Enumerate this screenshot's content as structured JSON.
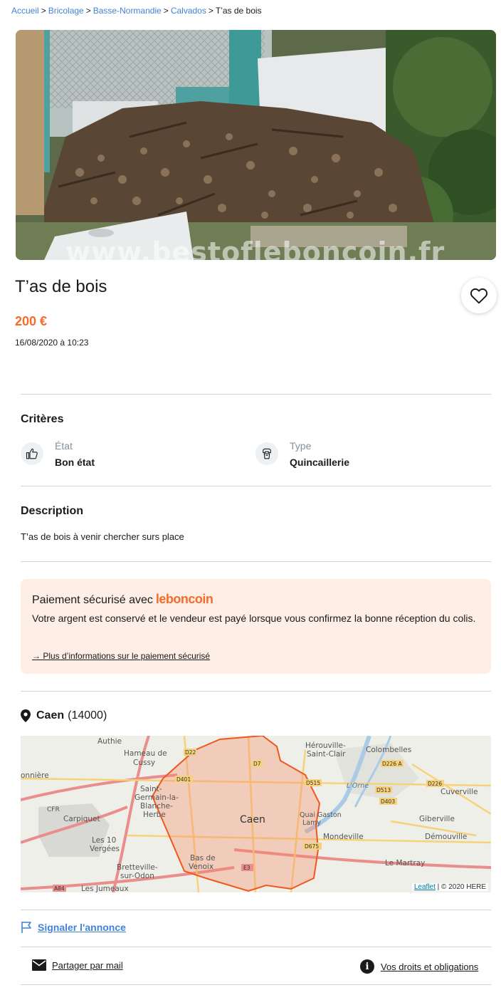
{
  "breadcrumb": {
    "items": [
      "Accueil",
      "Bricolage",
      "Basse-Normandie",
      "Calvados"
    ],
    "current": "T’as de bois",
    "separator": ">"
  },
  "ad": {
    "watermark": "www.bestofleboncoin.fr",
    "title": "T’as de bois",
    "price": "200 €",
    "date": "16/08/2020 à 10:23"
  },
  "criteria": {
    "heading": "Critères",
    "items": [
      {
        "label": "État",
        "value": "Bon état",
        "icon": "thumbs-up-icon"
      },
      {
        "label": "Type",
        "value": "Quincaillerie",
        "icon": "tools-icon"
      }
    ]
  },
  "description": {
    "heading": "Description",
    "text": "T’as de bois à venir chercher surs place"
  },
  "payment": {
    "title": "Paiement sécurisé avec",
    "brand": "leboncoin",
    "text": "Votre argent est conservé et le vendeur est payé lorsque vous confirmez la bonne réception du colis.",
    "link": "→ Plus d’informations sur le paiement sécurisé"
  },
  "location": {
    "city": "Caen",
    "zip": "(14000)"
  },
  "map": {
    "labels": {
      "authie": "Authie",
      "hameau1": "Hameau de",
      "hameau2": "Cussy",
      "herouville1": "Hérouville-",
      "herouville2": "Saint-Clair",
      "colombelles": "Colombelles",
      "saint1": "Saint-",
      "saint2": "Germain-la-",
      "saint3": "Blanche-",
      "saint4": "Herbe",
      "cfr": "CFR",
      "carpiquet": "Carpiquet",
      "caen": "Caen",
      "quai1": "Quai Gaston",
      "quai2": "Lamy",
      "lorne": "L'Orne",
      "cuverville": "Cuverville",
      "giberville": "Giberville",
      "mondeville": "Mondeville",
      "demouville": "Démouville",
      "les10_1": "Les 10",
      "les10_2": "Vergées",
      "bas1": "Bas de",
      "bas2": "Venoix",
      "bretteville1": "Bretteville-",
      "bretteville2": "sur-Odon",
      "lemartray": "Le Martray",
      "lesjumeaux": "Les Jumeaux",
      "onniere": "onnière",
      "d22": "D22",
      "d7": "D7",
      "d401": "D401",
      "d515": "D515",
      "d513": "D513",
      "d403": "D403",
      "d226a": "D226 A",
      "d226": "D226",
      "d675": "D675",
      "e3": "E3",
      "a84": "A84"
    },
    "attribution_leaflet": "Leaflet",
    "attribution_rest": " | © 2020 HERE"
  },
  "actions": {
    "report": "Signaler l'annonce",
    "share": "Partager par mail",
    "rights": "Vos droits et obligations"
  },
  "colors": {
    "accent": "#f56b2a",
    "link": "#4183d7",
    "payment_bg": "#fdeee6",
    "divider": "#cad1d9"
  }
}
